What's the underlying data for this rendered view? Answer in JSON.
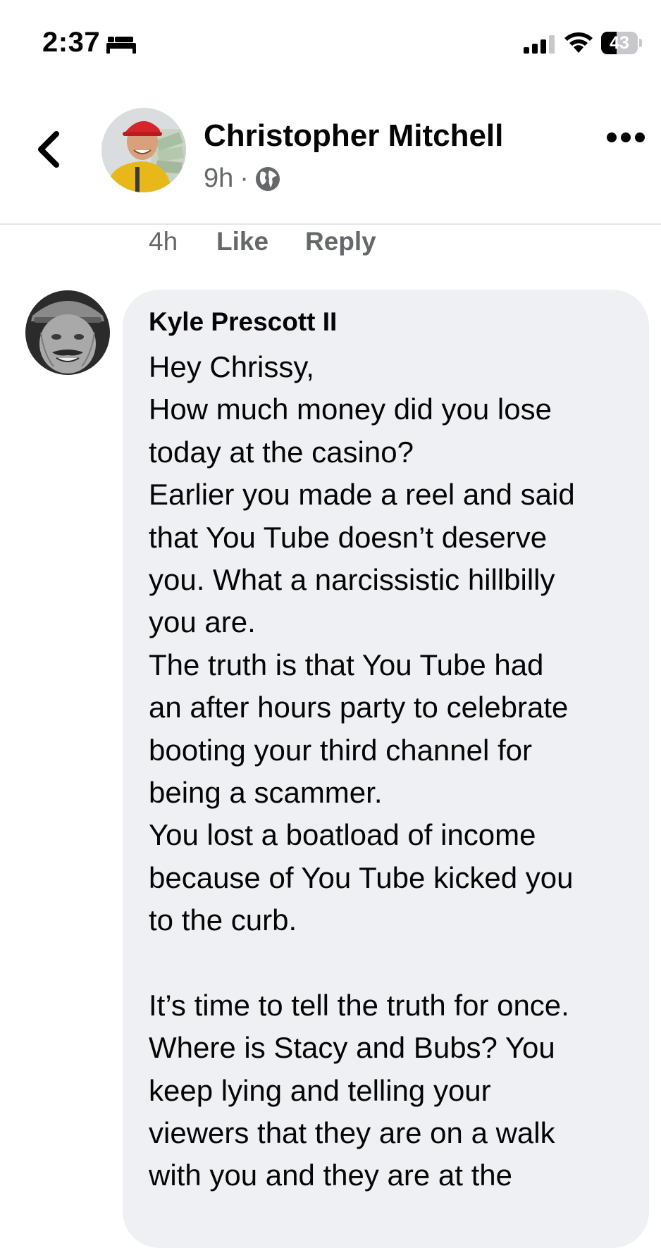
{
  "status_bar": {
    "time": "2:37",
    "battery": "43",
    "battery_fraction": 0.43
  },
  "post": {
    "author": "Christopher Mitchell",
    "age": "9h",
    "separator": "·"
  },
  "previous_comment": {
    "age": "4h",
    "like_label": "Like",
    "reply_label": "Reply"
  },
  "comment": {
    "author": "Kyle Prescott II",
    "lines": [
      "Hey Chrissy,",
      "How much money did you lose",
      "today at the casino?",
      "Earlier you made a reel and said",
      "that You Tube doesn’t deserve",
      "you. What a narcissistic hillbilly",
      "you are.",
      "The truth is that You Tube had",
      "an after hours party to celebrate",
      "booting your third channel for",
      "being a scammer.",
      "You lost a boatload of income",
      "because of You Tube kicked you",
      "to the curb.",
      "",
      "It’s time to tell the truth for once.",
      "Where is Stacy and Bubs? You",
      "keep lying and telling your",
      "viewers that they are on a walk",
      "with you and they are at the"
    ]
  },
  "colors": {
    "secondary_text": "#65676b",
    "bubble": "#eff0f4",
    "divider": "#e4e6eb"
  },
  "icons": [
    "sleep-icon",
    "signal-icon",
    "wifi-icon",
    "battery-icon",
    "back-arrow-icon",
    "globe-icon",
    "more-icon"
  ]
}
